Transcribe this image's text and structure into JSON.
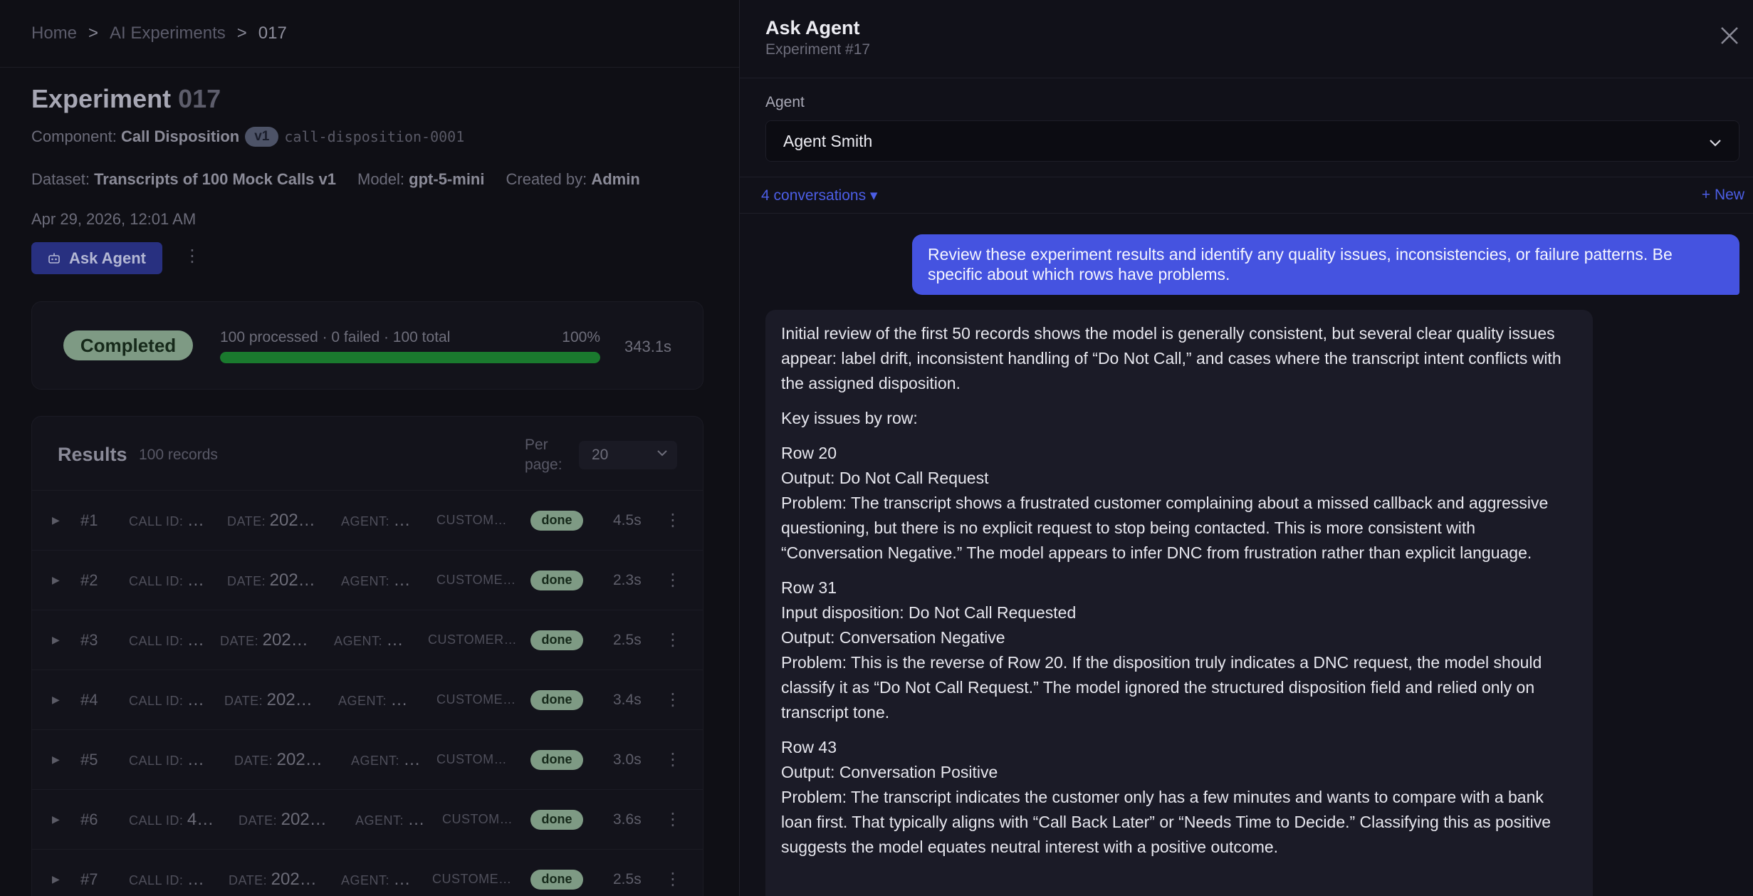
{
  "breadcrumb": {
    "home": "Home",
    "section": "AI Experiments",
    "current": "017",
    "separator": ">"
  },
  "experiment": {
    "title_word": "Experiment",
    "title_number": "017",
    "component_label": "Component:",
    "component_name": "Call Disposition",
    "version": "v1",
    "component_id": "call-disposition-0001",
    "dataset_label": "Dataset:",
    "dataset_name": "Transcripts of 100 Mock Calls v1",
    "model_label": "Model:",
    "model_name": "gpt-5-mini",
    "created_label": "Created by:",
    "created_by": "Admin",
    "date": "Apr 29, 2026, 12:01 AM",
    "ask_agent_label": "Ask Agent"
  },
  "progress": {
    "status": "Completed",
    "summary": "100 processed · 0 failed · 100 total",
    "percent_label": "100%",
    "fraction": 1.0,
    "duration": "343.1s"
  },
  "results": {
    "title": "Results",
    "count": "100 records",
    "per_page_label": "Per page:",
    "per_page_value": "20",
    "rows": [
      {
        "index": "#1",
        "call_id_label": "CALL ID:",
        "call_id": "…",
        "date_label": "DATE:",
        "date": "202…",
        "agent_label": "AGENT:",
        "agent": "…",
        "customer_label": "CUSTOM…",
        "status": "done",
        "time": "4.5s"
      },
      {
        "index": "#2",
        "call_id_label": "CALL ID:",
        "call_id": "…",
        "date_label": "DATE:",
        "date": "202…",
        "agent_label": "AGENT:",
        "agent": "…",
        "customer_label": "CUSTOME…",
        "status": "done",
        "time": "2.3s"
      },
      {
        "index": "#3",
        "call_id_label": "CALL ID:",
        "call_id": "…",
        "date_label": "DATE:",
        "date": "202…",
        "agent_label": "AGENT:",
        "agent": "…",
        "customer_label": "CUSTOMER…",
        "status": "done",
        "time": "2.5s"
      },
      {
        "index": "#4",
        "call_id_label": "CALL ID:",
        "call_id": "…",
        "date_label": "DATE:",
        "date": "202…",
        "agent_label": "AGENT:",
        "agent": "…",
        "customer_label": "CUSTOME…",
        "status": "done",
        "time": "3.4s"
      },
      {
        "index": "#5",
        "call_id_label": "CALL ID:",
        "call_id": "…",
        "date_label": "DATE:",
        "date": "202…",
        "agent_label": "AGENT:",
        "agent": "…",
        "customer_label": "CUSTOM…",
        "status": "done",
        "time": "3.0s"
      },
      {
        "index": "#6",
        "call_id_label": "CALL ID:",
        "call_id": "4…",
        "date_label": "DATE:",
        "date": "202…",
        "agent_label": "AGENT:",
        "agent": "…",
        "customer_label": "CUSTOM…",
        "status": "done",
        "time": "3.6s"
      },
      {
        "index": "#7",
        "call_id_label": "CALL ID:",
        "call_id": "…",
        "date_label": "DATE:",
        "date": "202…",
        "agent_label": "AGENT:",
        "agent": "…",
        "customer_label": "CUSTOME…",
        "status": "done",
        "time": "2.5s"
      }
    ]
  },
  "drawer": {
    "title": "Ask Agent",
    "subtitle": "Experiment #17",
    "agent_label": "Agent",
    "agent_selected": "Agent Smith",
    "conversations_label": "4 conversations ▾",
    "new_label": "+ New",
    "user_message": "Review these experiment results and identify any quality issues, inconsistencies, or failure patterns. Be specific about which rows have problems.",
    "agent_message": {
      "intro": "Initial review of the first 50 records shows the model is generally consistent, but several clear quality issues appear: label drift, inconsistent handling of “Do Not Call,” and cases where the transcript intent conflicts with the assigned disposition.",
      "key_issues": "Key issues by row:",
      "row20_title": "Row 20",
      "row20_output": "Output: Do Not Call Request",
      "row20_problem": "Problem: The transcript shows a frustrated customer complaining about a missed callback and aggressive questioning, but there is no explicit request to stop being contacted. This is more consistent with “Conversation Negative.” The model appears to infer DNC from frustration rather than explicit language.",
      "row31_title": "Row 31",
      "row31_input": "Input disposition: Do Not Call Requested",
      "row31_output": "Output: Conversation Negative",
      "row31_problem": "Problem: This is the reverse of Row 20. If the disposition truly indicates a DNC request, the model should classify it as “Do Not Call Request.” The model ignored the structured disposition field and relied only on transcript tone.",
      "row43_title": "Row 43",
      "row43_output": "Output: Conversation Positive",
      "row43_problem": "Problem: The transcript indicates the customer only has a few minutes and wants to compare with a bank loan first. That typically aligns with “Call Back Later” or “Needs Time to Decide.” Classifying this as positive suggests the model equates neutral interest with a positive outcome."
    }
  },
  "icons": {
    "close": "close-icon",
    "chevron": "chevron-down-icon",
    "robot": "robot-icon",
    "kebab": "kebab-icon",
    "expand": "expand-triangle-icon"
  },
  "colors": {
    "accent": "#4553e0",
    "success": "#1a7a2e",
    "done_badge": "#7e9a84"
  }
}
